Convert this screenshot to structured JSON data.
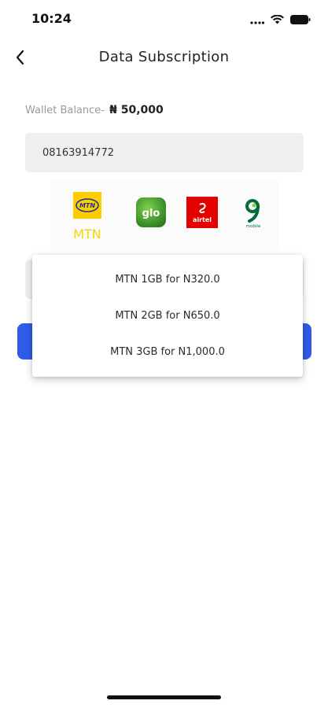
{
  "status_bar": {
    "time": "10:24"
  },
  "header": {
    "title": "Data Subscription"
  },
  "wallet": {
    "label": "Wallet Balance-",
    "amount": "₦ 50,000"
  },
  "phone_input": {
    "value": "08163914772"
  },
  "networks": [
    {
      "name": "MTN",
      "logo_text": "MTN",
      "selected": true,
      "color": "#ffcc00"
    },
    {
      "name": "glo",
      "logo_text": "glo",
      "selected": false,
      "color": "#3a9a2e"
    },
    {
      "name": "airtel",
      "logo_text": "airtel",
      "selected": false,
      "color": "#e40000"
    },
    {
      "name": "9mobile",
      "logo_text": "mobile",
      "selected": false,
      "color": "#006e3c"
    }
  ],
  "selected_network_label": "MTN",
  "plans": [
    {
      "label": "MTN 1GB for N320.0"
    },
    {
      "label": "MTN 2GB for N650.0"
    },
    {
      "label": "MTN 3GB for N1,000.0"
    }
  ],
  "colors": {
    "accent": "#2f5be6",
    "selected_label": "#f6d500",
    "field_bg": "#efefef"
  }
}
